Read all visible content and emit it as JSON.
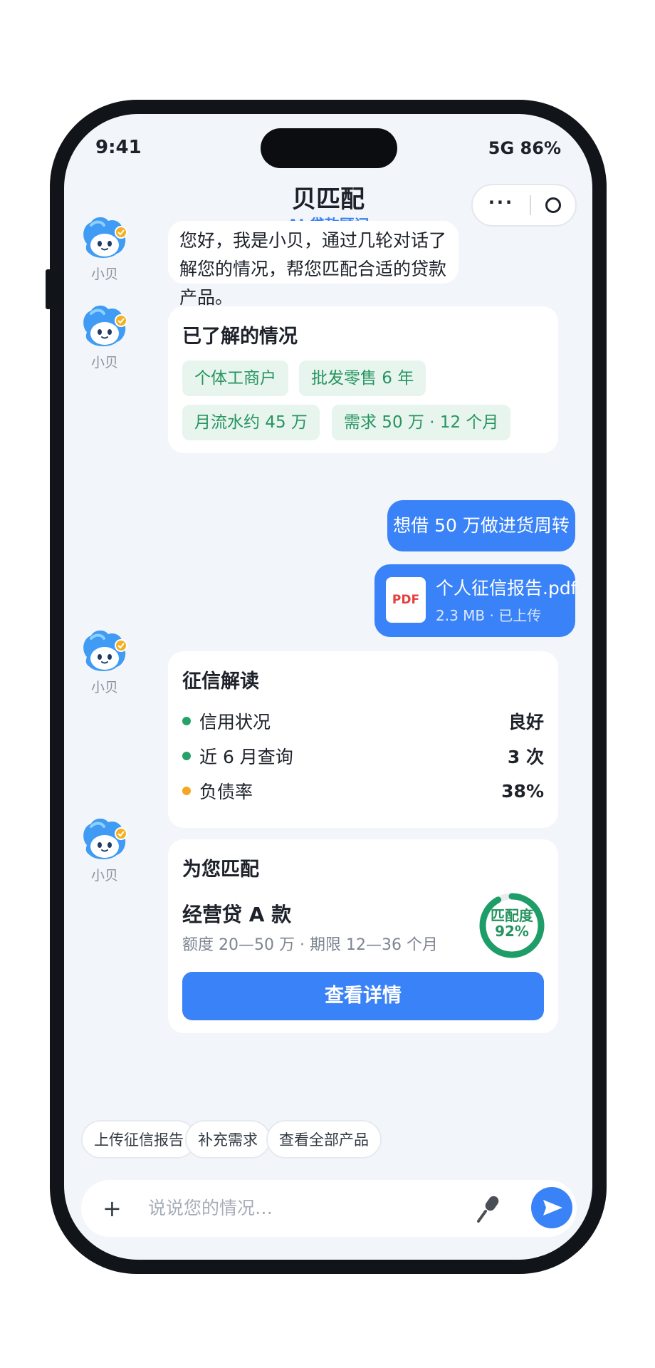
{
  "status_bar": {
    "time": "9:41",
    "network": "5G 86%"
  },
  "nav": {
    "title": "贝匹配",
    "subtitle": "AI 贷款顾问",
    "more_label": "···"
  },
  "assistant": {
    "name": "小贝"
  },
  "greeting": {
    "text": "您好，我是小贝，通过几轮对话了解您的情况，帮您匹配合适的贷款产品。"
  },
  "profile_card": {
    "title": "已了解的情况",
    "tags": [
      "个体工商户",
      "批发零售 6 年",
      "月流水约 45 万",
      "需求 50 万 · 12 个月"
    ]
  },
  "user_message": {
    "text": "想借 50 万做进货周转"
  },
  "file_message": {
    "icon_label": "PDF",
    "file_name": "个人征信报告.pdf",
    "meta": "2.3 MB · 已上传"
  },
  "credit_card": {
    "title": "征信解读",
    "rows": [
      {
        "label": "信用状况",
        "value": "良好",
        "status_color": "#26a169"
      },
      {
        "label": "近 6 月查询",
        "value": "3 次",
        "status_color": "#26a169"
      },
      {
        "label": "负债率",
        "value": "38%",
        "status_color": "#f5a623"
      }
    ]
  },
  "match_card": {
    "title": "为您匹配",
    "product_name": "经营贷 A 款",
    "product_desc": "额度 20—50 万 · 期限 12—36 个月",
    "match_label": "匹配度",
    "match_value": "92%",
    "match_fraction": 0.92,
    "button_label": "查看详情"
  },
  "quick_replies": [
    "上传征信报告",
    "补充需求",
    "查看全部产品"
  ],
  "input": {
    "plus_label": "+",
    "placeholder": "说说您的情况…"
  },
  "colors": {
    "accent": "#3a82f7",
    "success": "#26945f",
    "warning": "#f5a623"
  },
  "icons": {
    "more": "more-dots-icon",
    "close": "circle-icon",
    "mic": "microphone-icon",
    "send": "send-icon",
    "file": "pdf-icon"
  }
}
